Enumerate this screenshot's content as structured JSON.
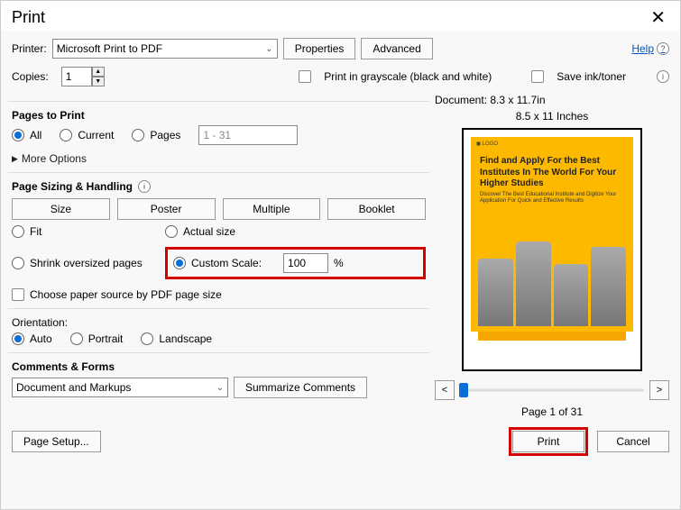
{
  "window": {
    "title": "Print"
  },
  "header": {
    "printer_label": "Printer:",
    "printer_value": "Microsoft Print to PDF",
    "properties": "Properties",
    "advanced": "Advanced",
    "help": "Help",
    "copies_label": "Copies:",
    "copies_value": "1",
    "grayscale": "Print in grayscale (black and white)",
    "save_ink": "Save ink/toner"
  },
  "pages": {
    "heading": "Pages to Print",
    "all": "All",
    "current": "Current",
    "pages": "Pages",
    "range_placeholder": "1 - 31",
    "more": "More Options"
  },
  "sizing": {
    "heading": "Page Sizing & Handling",
    "size": "Size",
    "poster": "Poster",
    "multiple": "Multiple",
    "booklet": "Booklet",
    "fit": "Fit",
    "actual": "Actual size",
    "shrink": "Shrink oversized pages",
    "custom": "Custom Scale:",
    "custom_val": "100",
    "pct": "%",
    "choose_paper": "Choose paper source by PDF page size"
  },
  "orientation": {
    "heading": "Orientation:",
    "auto": "Auto",
    "portrait": "Portrait",
    "landscape": "Landscape"
  },
  "comments": {
    "heading": "Comments & Forms",
    "value": "Document and Markups",
    "summarize": "Summarize Comments"
  },
  "preview": {
    "doc_dims": "Document: 8.3 x 11.7in",
    "paper": "8.5 x 11 Inches",
    "pv_title": "Find and Apply For the Best Institutes In The World For Your Higher Studies",
    "pv_sub": "Discover The Best Educational Institute and Digitize Your Application For Quick and Effective Results",
    "page_label": "Page 1 of 31",
    "prev": "<",
    "next": ">"
  },
  "footer": {
    "page_setup": "Page Setup...",
    "print": "Print",
    "cancel": "Cancel"
  }
}
